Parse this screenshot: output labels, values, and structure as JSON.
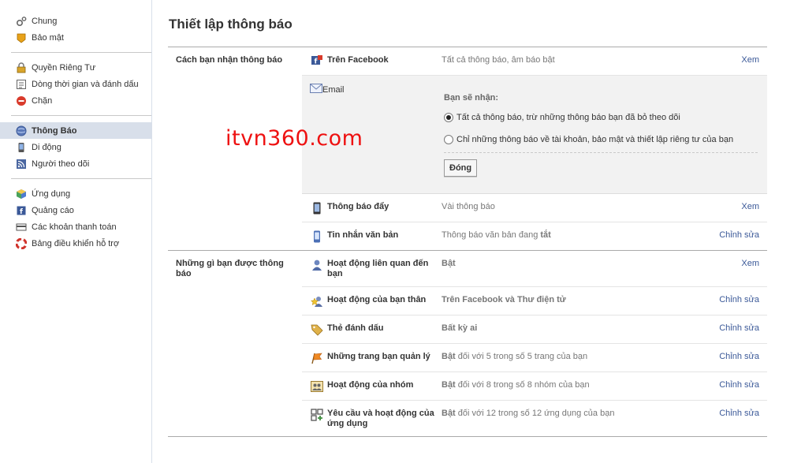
{
  "sidebar": {
    "groups": [
      [
        {
          "label": "Chung",
          "icon": "gear-icon"
        },
        {
          "label": "Bảo mật",
          "icon": "badge-icon"
        }
      ],
      [
        {
          "label": "Quyền Riêng Tư",
          "icon": "lock-icon"
        },
        {
          "label": "Dòng thời gian và đánh dấu",
          "icon": "timeline-icon"
        },
        {
          "label": "Chặn",
          "icon": "block-icon"
        }
      ],
      [
        {
          "label": "Thông Báo",
          "icon": "globe-icon",
          "active": true
        },
        {
          "label": "Di động",
          "icon": "mobile-icon"
        },
        {
          "label": "Người theo dõi",
          "icon": "rss-icon"
        }
      ],
      [
        {
          "label": "Ứng dụng",
          "icon": "apps-icon"
        },
        {
          "label": "Quảng cáo",
          "icon": "ads-icon"
        },
        {
          "label": "Các khoản thanh toán",
          "icon": "payment-icon"
        },
        {
          "label": "Bảng điều khiển hỗ trợ",
          "icon": "lifebuoy-icon"
        }
      ]
    ]
  },
  "main": {
    "title": "Thiết lập thông báo",
    "section1": {
      "label": "Cách bạn nhận thông báo",
      "facebook": {
        "name": "Trên Facebook",
        "value": "Tất cả thông báo, âm báo bật",
        "action": "Xem"
      },
      "email": {
        "name": "Email",
        "receive_heading": "Bạn sẽ nhận:",
        "options": [
          {
            "label": "Tất cả thông báo, trừ những thông báo bạn đã bỏ theo dõi",
            "checked": true
          },
          {
            "label": "Chỉ những thông báo về tài khoản, bảo mật và thiết lập riêng tư của bạn",
            "checked": false
          }
        ],
        "close_label": "Đóng"
      },
      "push": {
        "name": "Thông báo đẩy",
        "value": "Vài thông báo",
        "action": "Xem"
      },
      "sms": {
        "name": "Tin nhắn văn bản",
        "value_prefix": "Thông báo văn bản đang ",
        "value_bold": "tắt",
        "action": "Chỉnh sửa"
      }
    },
    "section2": {
      "label": "Những gì bạn được thông báo",
      "rows": [
        {
          "name": "Hoạt động liên quan đến bạn",
          "bold": "Bật",
          "rest": "",
          "action": "Xem",
          "icon": "person-icon"
        },
        {
          "name": "Hoạt động của bạn thân",
          "bold": "Trên Facebook và Thư điện tử",
          "rest": "",
          "action": "Chỉnh sửa",
          "icon": "star-person-icon"
        },
        {
          "name": "Thẻ đánh dấu",
          "bold": "Bất kỳ ai",
          "rest": "",
          "action": "Chỉnh sửa",
          "icon": "tag-icon"
        },
        {
          "name": "Những trang bạn quản lý",
          "bold": "Bật",
          "rest": " đối với 5 trong số 5 trang của bạn",
          "action": "Chỉnh sửa",
          "icon": "flag-icon"
        },
        {
          "name": "Hoạt động của nhóm",
          "bold": "Bật",
          "rest": " đối với 8 trong số 8 nhóm của bạn",
          "action": "Chỉnh sửa",
          "icon": "group-icon"
        },
        {
          "name": "Yêu cầu và hoạt động của ứng dụng",
          "bold": "Bật",
          "rest": " đối với 12 trong số 12 ứng dụng của bạn",
          "action": "Chỉnh sửa",
          "icon": "app-request-icon"
        }
      ]
    }
  },
  "watermark": "itvn360.com"
}
